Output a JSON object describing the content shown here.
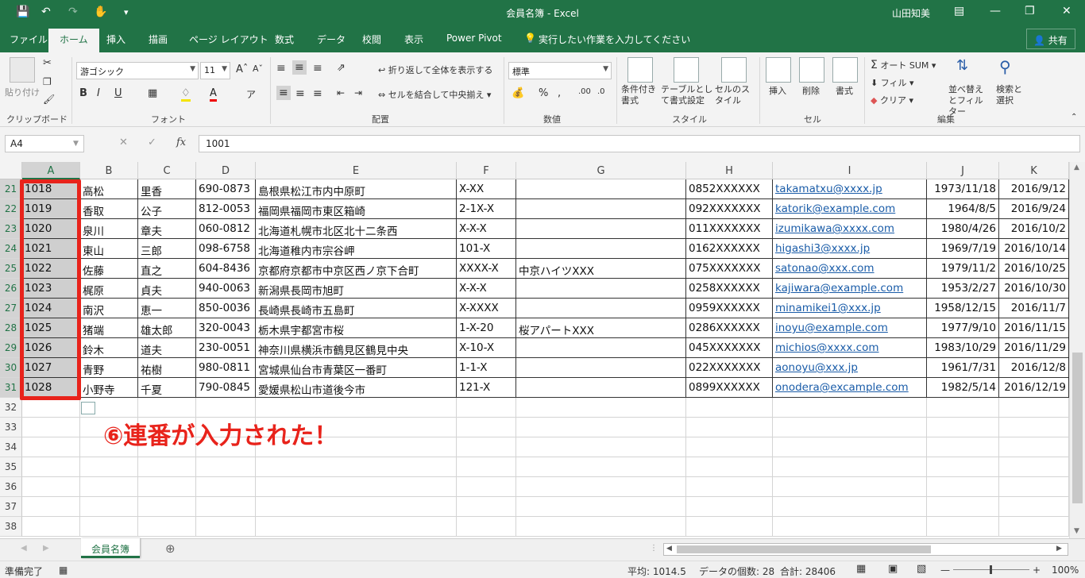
{
  "titlebar": {
    "title": "会員名簿 - Excel",
    "user": "山田知美",
    "icons": {
      "save": "save-icon",
      "undo": "undo-icon",
      "redo": "redo-icon",
      "touch": "touch-mode-icon",
      "customize": "customize-qat-icon"
    }
  },
  "tabs": {
    "items": [
      "ファイル",
      "ホーム",
      "挿入",
      "描画",
      "ページ レイアウト",
      "数式",
      "データ",
      "校閲",
      "表示",
      "Power Pivot"
    ],
    "tell_me": "実行したい作業を入力してください",
    "share": "共有"
  },
  "ribbon": {
    "clipboard": {
      "label": "クリップボード",
      "paste": "貼り付け"
    },
    "font": {
      "label": "フォント",
      "font_name": "游ゴシック",
      "font_size": "11",
      "bold": "B",
      "italic": "I",
      "underline": "U"
    },
    "alignment": {
      "label": "配置",
      "wrap": "折り返して全体を表示する",
      "merge": "セルを結合して中央揃え"
    },
    "number": {
      "label": "数値",
      "format": "標準",
      "percent": "%"
    },
    "styles": {
      "label": "スタイル",
      "conditional": "条件付き書式",
      "table": "テーブルとして書式設定",
      "cell_styles": "セルのスタイル"
    },
    "cells": {
      "label": "セル",
      "insert": "挿入",
      "delete": "削除",
      "format": "書式"
    },
    "editing": {
      "label": "編集",
      "autosum": "オート SUM",
      "fill": "フィル",
      "clear": "クリア",
      "sort": "並べ替えとフィルター",
      "find": "検索と選択"
    }
  },
  "formula_bar": {
    "name_box": "A4",
    "fx": "fx",
    "value": "1001"
  },
  "columns": [
    "A",
    "B",
    "C",
    "D",
    "E",
    "F",
    "G",
    "H",
    "I",
    "J",
    "K"
  ],
  "rows": [
    {
      "n": "21",
      "cells": [
        "1018",
        "高松",
        "里香",
        "690-0873",
        "島根県松江市内中原町",
        "X-XX",
        "",
        "0852XXXXXX",
        "takamatxu@xxxx.jp",
        "1973/11/18",
        "2016/9/12"
      ]
    },
    {
      "n": "22",
      "cells": [
        "1019",
        "香取",
        "公子",
        "812-0053",
        "福岡県福岡市東区箱崎",
        "2-1X-X",
        "",
        "092XXXXXXX",
        "katorik@example.com",
        "1964/8/5",
        "2016/9/24"
      ]
    },
    {
      "n": "23",
      "cells": [
        "1020",
        "泉川",
        "章夫",
        "060-0812",
        "北海道札幌市北区北十二条西",
        "X-X-X",
        "",
        "011XXXXXXX",
        "izumikawa@xxxx.com",
        "1980/4/26",
        "2016/10/2"
      ]
    },
    {
      "n": "24",
      "cells": [
        "1021",
        "東山",
        "三郎",
        "098-6758",
        "北海道稚内市宗谷岬",
        "101-X",
        "",
        "0162XXXXXX",
        "higashi3@xxxx.jp",
        "1969/7/19",
        "2016/10/14"
      ]
    },
    {
      "n": "25",
      "cells": [
        "1022",
        "佐藤",
        "直之",
        "604-8436",
        "京都府京都市中京区西ノ京下合町",
        "XXXX-X",
        "中京ハイツXXX",
        "075XXXXXXX",
        "satonao@xxx.com",
        "1979/11/2",
        "2016/10/25"
      ]
    },
    {
      "n": "26",
      "cells": [
        "1023",
        "梶原",
        "貞夫",
        "940-0063",
        "新潟県長岡市旭町",
        "X-X-X",
        "",
        "0258XXXXXX",
        "kajiwara@example.com",
        "1953/2/27",
        "2016/10/30"
      ]
    },
    {
      "n": "27",
      "cells": [
        "1024",
        "南沢",
        "恵一",
        "850-0036",
        "長崎県長崎市五島町",
        "X-XXXX",
        "",
        "0959XXXXXX",
        "minamikei1@xxx.jp",
        "1958/12/15",
        "2016/11/7"
      ]
    },
    {
      "n": "28",
      "cells": [
        "1025",
        "猪端",
        "雄太郎",
        "320-0043",
        "栃木県宇都宮市桜",
        "1-X-20",
        "桜アパートXXX",
        "0286XXXXXX",
        "inoyu@example.com",
        "1977/9/10",
        "2016/11/15"
      ]
    },
    {
      "n": "29",
      "cells": [
        "1026",
        "鈴木",
        "道夫",
        "230-0051",
        "神奈川県横浜市鶴見区鶴見中央",
        "X-10-X",
        "",
        "045XXXXXXX",
        "michios@xxxx.com",
        "1983/10/29",
        "2016/11/29"
      ]
    },
    {
      "n": "30",
      "cells": [
        "1027",
        "青野",
        "祐樹",
        "980-0811",
        "宮城県仙台市青葉区一番町",
        "1-1-X",
        "",
        "022XXXXXXX",
        "aonoyu@xxx.jp",
        "1961/7/31",
        "2016/12/8"
      ]
    },
    {
      "n": "31",
      "cells": [
        "1028",
        "小野寺",
        "千夏",
        "790-0845",
        "愛媛県松山市道後今市",
        "121-X",
        "",
        "0899XXXXXX",
        "onodera@excample.com",
        "1982/5/14",
        "2016/12/19"
      ]
    }
  ],
  "empty_rows": [
    "32",
    "33",
    "34",
    "35",
    "36",
    "37",
    "38"
  ],
  "annotation": "⑥連番が入力された！",
  "sheet_tab": "会員名簿",
  "status": {
    "ready": "準備完了",
    "average": "平均: 1014.5",
    "count": "データの個数: 28",
    "sum": "合計: 28406",
    "zoom": "100%"
  },
  "colors": {
    "accent": "#217346",
    "annotation": "#e8231b",
    "link": "#1a5ca8"
  }
}
